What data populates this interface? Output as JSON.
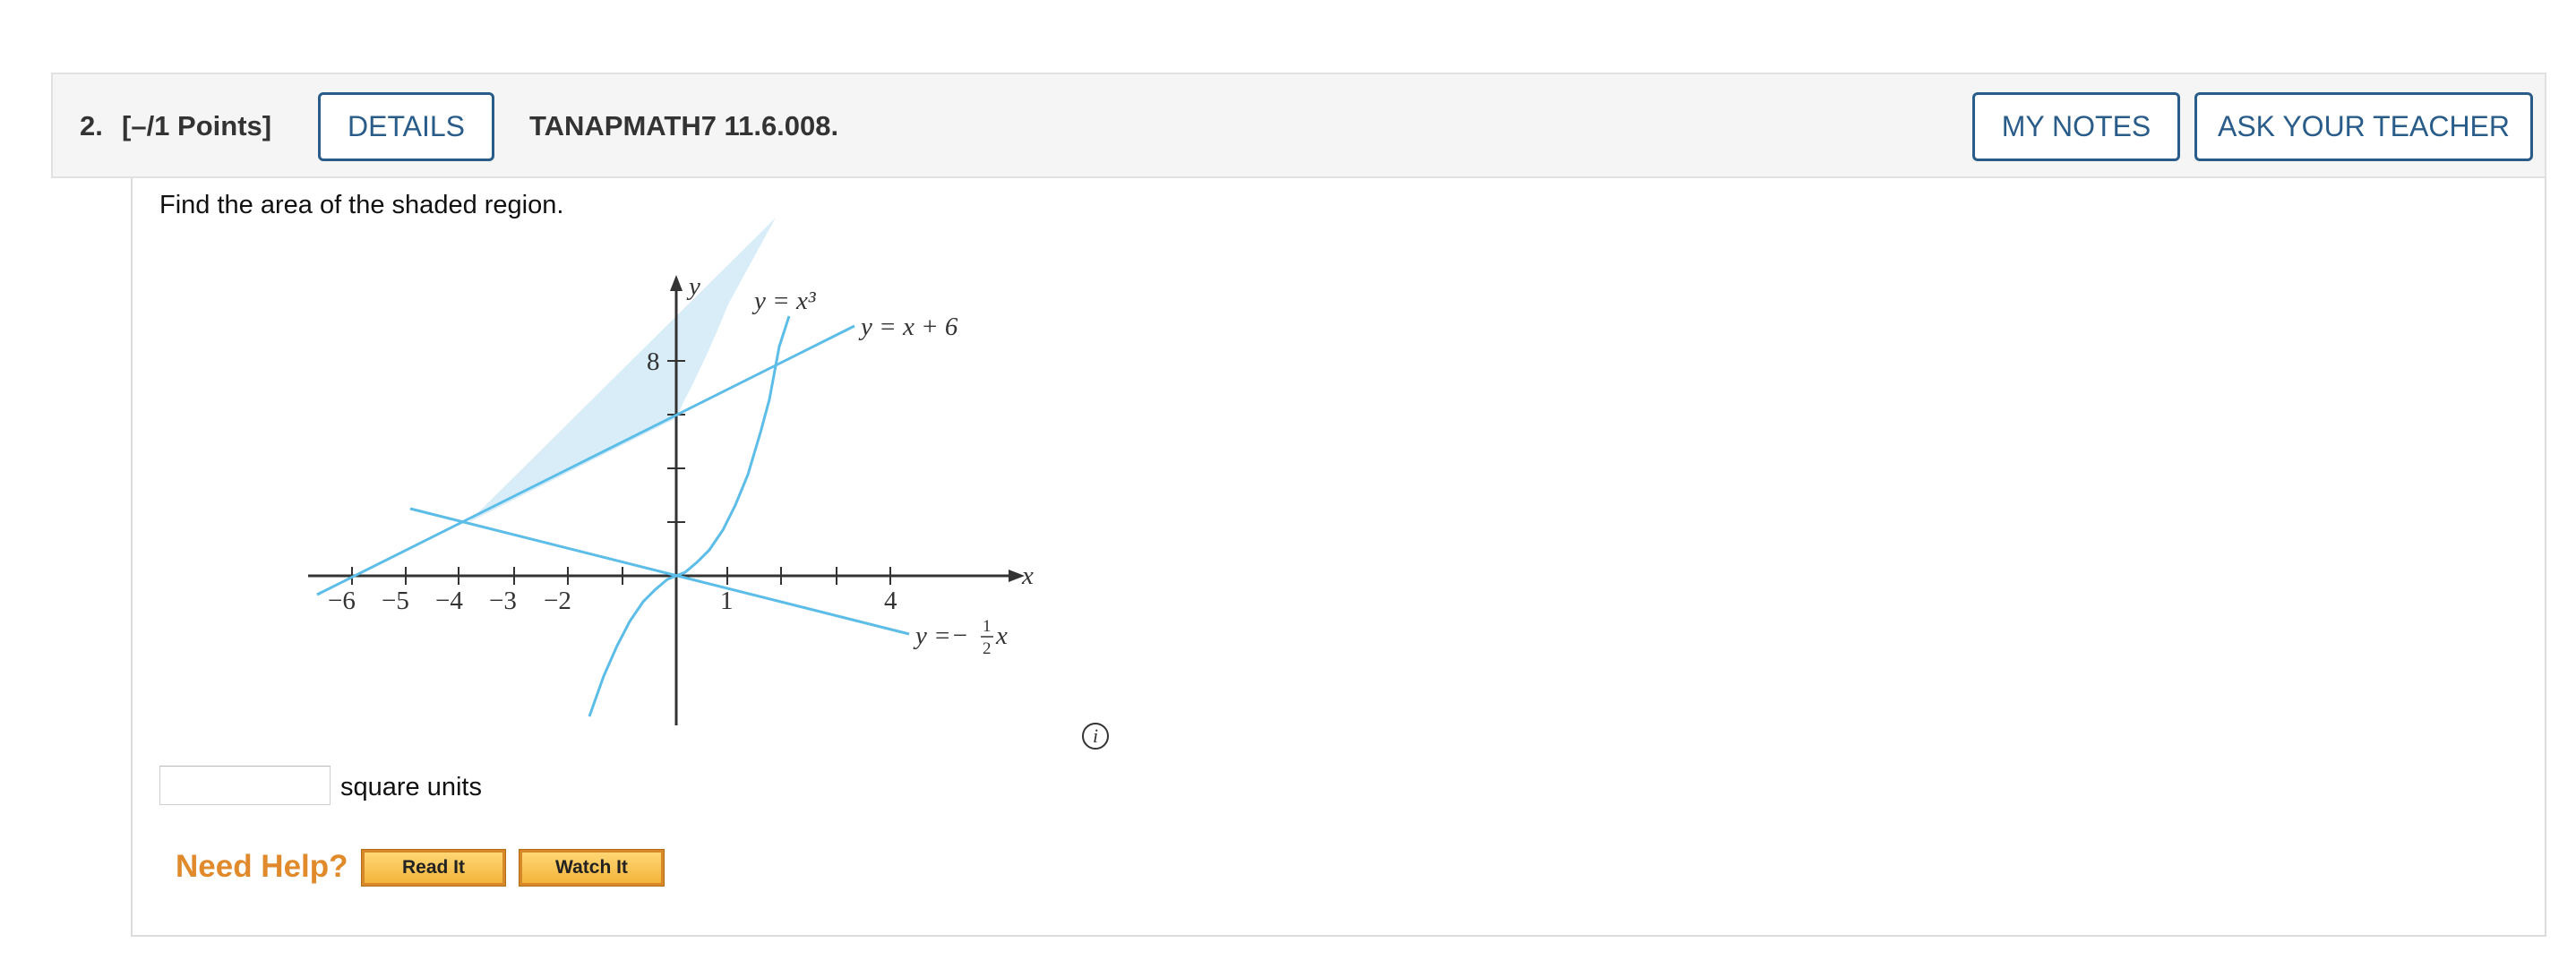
{
  "question": {
    "number": "2.",
    "points": "[–/1 Points]",
    "details_label": "DETAILS",
    "code": "TANAPMATH7 11.6.008.",
    "my_notes_label": "MY NOTES",
    "ask_teacher_label": "ASK YOUR TEACHER"
  },
  "body": {
    "prompt": "Find the area of the shaded region.",
    "answer_value": "",
    "units_label": "square units",
    "info_glyph": "i"
  },
  "figure": {
    "axis_x_label": "x",
    "axis_y_label": "y",
    "y_tick_label": "8",
    "x_tick_labels": [
      "−6",
      "−5",
      "−4",
      "−3",
      "−2",
      "1",
      "4"
    ],
    "curve_label_cubic": "y = x³",
    "curve_label_line": "y = x + 6",
    "curve_label_neg_lhs": "y =−",
    "curve_label_neg_frac_num": "1",
    "curve_label_neg_frac_den": "2",
    "curve_label_neg_var": "x",
    "curve_color": "#5bbde8",
    "shade_color": "#d9edf8"
  },
  "help": {
    "label": "Need Help?",
    "read_it_label": "Read It",
    "watch_it_label": "Watch It",
    "accent_color": "#e08a2c"
  }
}
